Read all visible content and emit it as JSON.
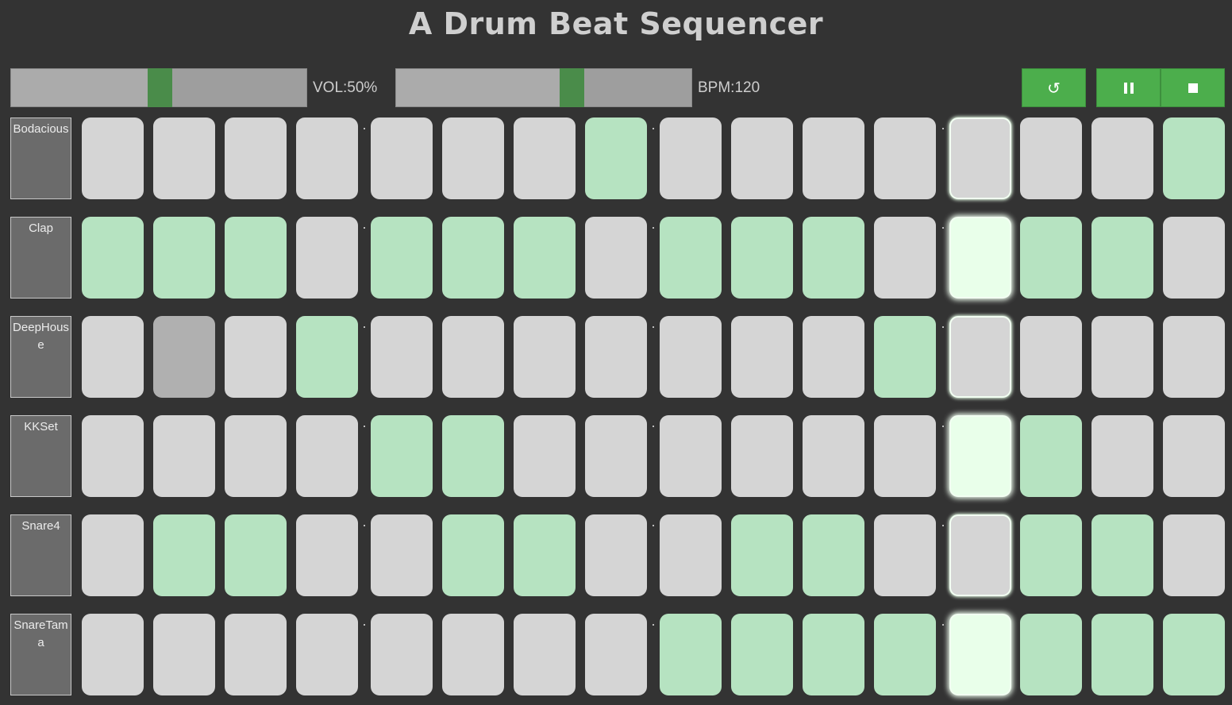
{
  "title": "A Drum Beat Sequencer",
  "volume": {
    "label": "VOL:50%",
    "level": 0.5
  },
  "tempo": {
    "label": "BPM:120",
    "level": 0.6
  },
  "controls": [
    {
      "name": "reset-button",
      "icon": "reset-icon",
      "glyph": "↺"
    },
    {
      "name": "pause-button",
      "icon": "pause-icon",
      "glyph": ""
    },
    {
      "name": "stop-button",
      "icon": "stop-icon",
      "glyph": ""
    }
  ],
  "colors": {
    "background": "#333333",
    "accent": "#4cae4c",
    "pad_off": "#d5d5d5",
    "pad_on": "#b6e3c1",
    "playhead_on": "#e9ffea"
  },
  "current_step": 12,
  "tracks": [
    {
      "name": "Bodacious",
      "steps": [
        0,
        0,
        0,
        0,
        0,
        0,
        0,
        1,
        0,
        0,
        0,
        0,
        0,
        0,
        0,
        1
      ]
    },
    {
      "name": "Clap",
      "steps": [
        1,
        1,
        1,
        0,
        1,
        1,
        1,
        0,
        1,
        1,
        1,
        0,
        1,
        1,
        1,
        0
      ]
    },
    {
      "name": "DeepHouse",
      "steps": [
        0,
        2,
        0,
        1,
        0,
        0,
        0,
        0,
        0,
        0,
        0,
        1,
        0,
        0,
        0,
        0
      ]
    },
    {
      "name": "KKSet",
      "steps": [
        0,
        0,
        0,
        0,
        1,
        1,
        0,
        0,
        0,
        0,
        0,
        0,
        1,
        1,
        0,
        0
      ]
    },
    {
      "name": "Snare4",
      "steps": [
        0,
        1,
        1,
        0,
        0,
        1,
        1,
        0,
        0,
        1,
        1,
        0,
        0,
        1,
        1,
        0
      ]
    },
    {
      "name": "SnareTama",
      "steps": [
        0,
        0,
        0,
        0,
        0,
        0,
        0,
        0,
        1,
        1,
        1,
        1,
        1,
        1,
        1,
        1
      ]
    }
  ]
}
